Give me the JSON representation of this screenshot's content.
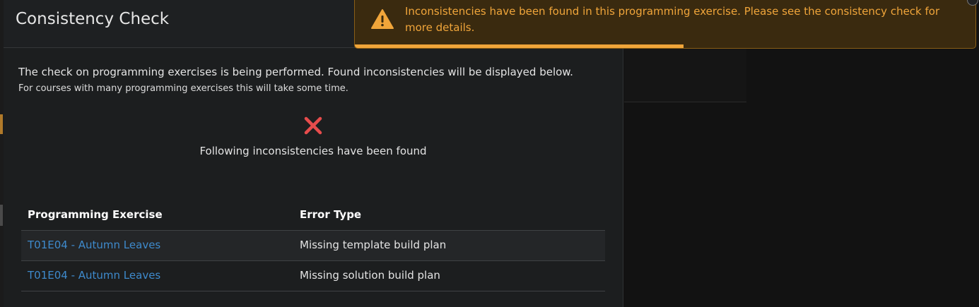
{
  "modal": {
    "title": "Consistency Check",
    "intro": "The check on programming exercises is being performed. Found inconsistencies will be displayed below.",
    "intro_small": "For courses with many programming exercises this will take some time.",
    "status_icon": "x-mark-icon",
    "status_text": "Following inconsistencies have been found"
  },
  "table": {
    "headers": [
      "Programming Exercise",
      "Error Type"
    ],
    "rows": [
      {
        "exercise": "T01E04 - Autumn Leaves",
        "error": "Missing template build plan"
      },
      {
        "exercise": "T01E04 - Autumn Leaves",
        "error": "Missing solution build plan"
      }
    ]
  },
  "toast": {
    "icon": "warning-triangle-icon",
    "message": "Inconsistencies have been found in this programming exercise. Please see the consistency check for more details.",
    "progress": 0.53,
    "color": "#f0a53a"
  },
  "colors": {
    "link": "#3e8acc",
    "error": "#e74c4c",
    "warning": "#f0a53a"
  }
}
